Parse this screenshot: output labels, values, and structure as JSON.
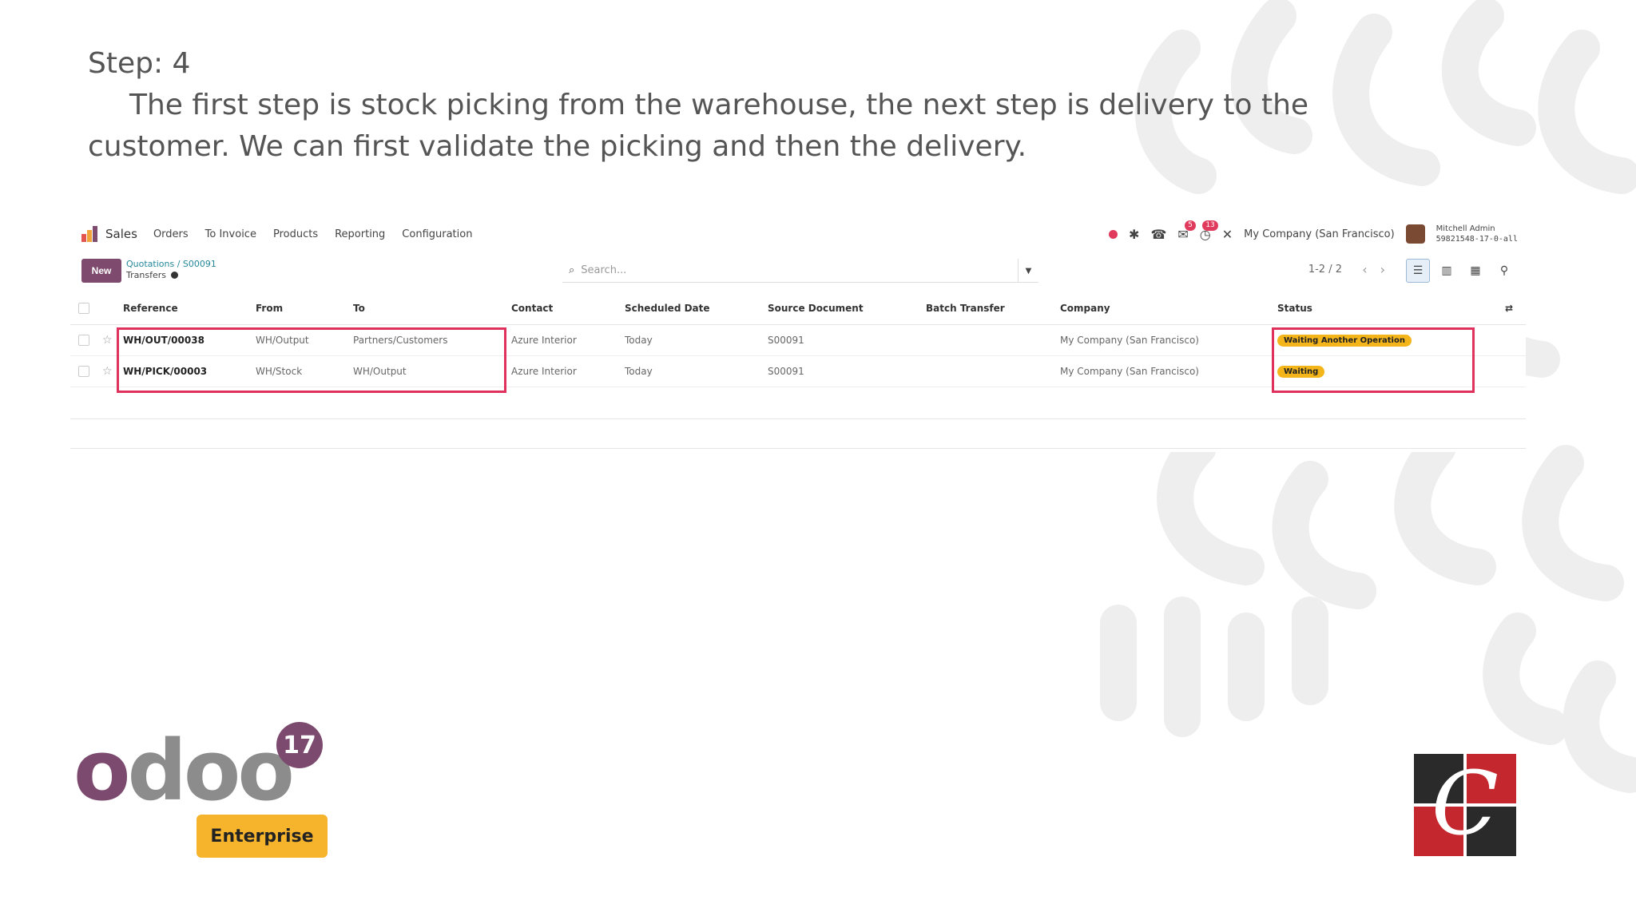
{
  "slide": {
    "step_title": "Step: 4",
    "step_body": "The first step is stock picking from the warehouse, the next step is delivery to the customer. We can first validate the picking and then the delivery."
  },
  "navbar": {
    "brand": "Sales",
    "menu": [
      "Orders",
      "To Invoice",
      "Products",
      "Reporting",
      "Configuration"
    ],
    "chat_count": "5",
    "activity_count": "13",
    "company": "My Company (San Francisco)",
    "user_name": "Mitchell Admin",
    "database": "59821548-17-0-all"
  },
  "control": {
    "new_label": "New",
    "breadcrumb": [
      "Quotations",
      "S00091"
    ],
    "current_view": "Transfers",
    "search_placeholder": "Search...",
    "pager": "1-2 / 2"
  },
  "table": {
    "columns": [
      "Reference",
      "From",
      "To",
      "Contact",
      "Scheduled Date",
      "Source Document",
      "Batch Transfer",
      "Company",
      "Status"
    ],
    "rows": [
      {
        "reference": "WH/OUT/00038",
        "from": "WH/Output",
        "to": "Partners/Customers",
        "contact": "Azure Interior",
        "scheduled_date": "Today",
        "source_document": "S00091",
        "batch_transfer": "",
        "company": "My Company (San Francisco)",
        "status": "Waiting Another Operation"
      },
      {
        "reference": "WH/PICK/00003",
        "from": "WH/Stock",
        "to": "WH/Output",
        "contact": "Azure Interior",
        "scheduled_date": "Today",
        "source_document": "S00091",
        "batch_transfer": "",
        "company": "My Company (San Francisco)",
        "status": "Waiting"
      }
    ]
  },
  "branding": {
    "odoo_first": "o",
    "odoo_rest": "doo",
    "version": "17",
    "edition": "Enterprise"
  },
  "colors": {
    "highlight": "#e0305c",
    "odoo_purple": "#7c4a6e",
    "status_badge": "#f3b51a",
    "enterprise_badge": "#f6b42c",
    "corner_red": "#c4272d",
    "corner_dark": "#2a2a2a"
  }
}
